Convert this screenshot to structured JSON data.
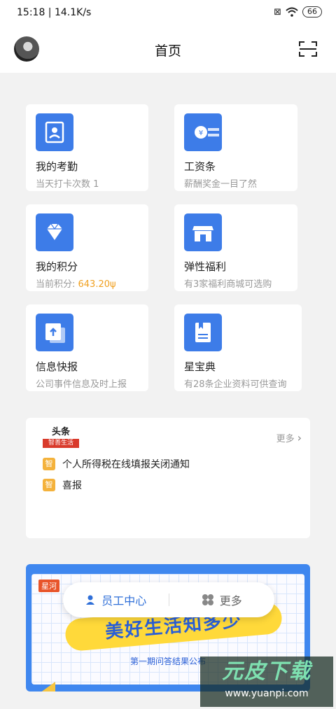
{
  "status_bar": {
    "time": "15:18 | 14.1K/s",
    "battery": "66"
  },
  "header": {
    "title": "首页"
  },
  "tiles": [
    {
      "title": "我的考勤",
      "subtitle": "当天打卡次数 1",
      "icon": "attendance-icon"
    },
    {
      "title": "工资条",
      "subtitle": "薪酬奖金一目了然",
      "icon": "salary-icon"
    },
    {
      "title": "我的积分",
      "subtitle_prefix": "当前积分: ",
      "points_value": "643.20ψ",
      "icon": "diamond-icon"
    },
    {
      "title": "弹性福利",
      "subtitle": "有3家福利商城可选购",
      "icon": "shop-icon"
    },
    {
      "title": "信息快报",
      "subtitle": "公司事件信息及时上报",
      "icon": "upload-icon"
    },
    {
      "title": "星宝典",
      "subtitle": "有28条企业资料可供查询",
      "icon": "book-icon"
    }
  ],
  "news": {
    "logo_top": "头条",
    "logo_bottom": "智善生活",
    "more_label": "更多",
    "badge": "智",
    "items": [
      "个人所得税在线填报关闭通知",
      "喜报"
    ]
  },
  "banner": {
    "tag": "星河",
    "headline": "美好生活知多少",
    "caption": "第一期问答结果公布"
  },
  "fab": {
    "staff_center": "员工中心",
    "more": "更多"
  },
  "watermark": {
    "brand": "元皮下载",
    "url": "www.yuanpi.com"
  },
  "colors": {
    "accent": "#3d7ce8",
    "points": "#f0a020",
    "badge": "#f4b23c"
  }
}
